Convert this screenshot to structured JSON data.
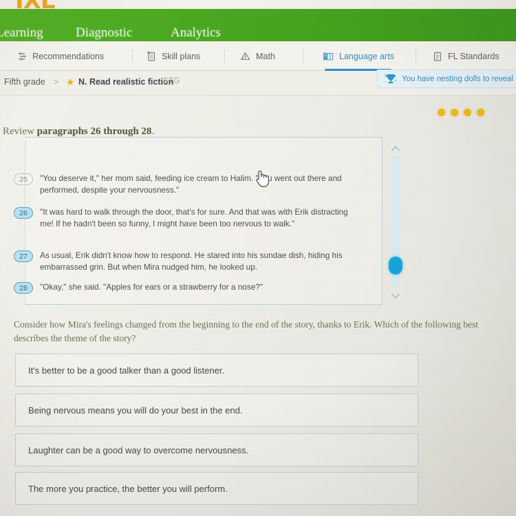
{
  "brand": {
    "logo_text": "IXL",
    "logo_color": "#f4a81d",
    "nav_color": "#4aaa20",
    "accent_blue": "#2a93d5"
  },
  "topnav": {
    "items": [
      {
        "label": "Learning"
      },
      {
        "label": "Diagnostic"
      },
      {
        "label": "Analytics"
      }
    ]
  },
  "tabs": [
    {
      "label": "Recommendations",
      "icon": "recommendations-icon",
      "active": false
    },
    {
      "label": "Skill plans",
      "icon": "skill-plans-icon",
      "active": false
    },
    {
      "label": "Math",
      "icon": "math-icon",
      "active": false
    },
    {
      "label": "Language arts",
      "icon": "language-arts-icon",
      "active": true
    },
    {
      "label": "FL Standards",
      "icon": "fl-standards-icon",
      "active": false
    }
  ],
  "breadcrumb": {
    "grade": "Fifth grade",
    "separator": ">",
    "star_icon": "star-icon",
    "skill": "N. Read realistic fiction",
    "code": "STG"
  },
  "notification": {
    "icon": "trophy-icon",
    "text": "You have nesting dolls to reveal"
  },
  "progress": {
    "dots": 4,
    "dot_color": "#f2bc1b"
  },
  "review": {
    "prefix": "Review ",
    "emphasis": "paragraphs 26 through 28",
    "suffix": "."
  },
  "passage": {
    "paragraphs": [
      {
        "number": "25",
        "highlighted": false,
        "text": "\"You deserve it,\" her mom said, feeding ice cream to Halim. \"You went out there and performed, despite your nervousness.\""
      },
      {
        "number": "26",
        "highlighted": true,
        "text": "\"It was hard to walk through the door, that's for sure. And that was with Erik distracting me! If he hadn't been so funny, I might have been too nervous to walk.\""
      },
      {
        "number": "27",
        "highlighted": true,
        "text": "As usual, Erik didn't know how to respond. He stared into his sundae dish, hiding his embarrassed grin. But when Mira nudged him, he looked up."
      },
      {
        "number": "28",
        "highlighted": true,
        "text": "\"Okay,\" she said. \"Apples for ears or a strawberry for a nose?\""
      }
    ],
    "scrollbar": {
      "up_icon": "chevron-up-icon",
      "down_icon": "chevron-down-icon",
      "thumb": "scrollbar-thumb"
    }
  },
  "cursor": {
    "icon": "pointer-hand-cursor"
  },
  "question": {
    "text": "Consider how Mira's feelings changed from the beginning to the end of the story, thanks to Erik. Which of the following best describes the theme of the story?"
  },
  "choices": [
    {
      "label": "It's better to be a good talker than a good listener."
    },
    {
      "label": "Being nervous means you will do your best in the end."
    },
    {
      "label": "Laughter can be a good way to overcome nervousness."
    },
    {
      "label": "The more you practice, the better you will perform."
    }
  ]
}
